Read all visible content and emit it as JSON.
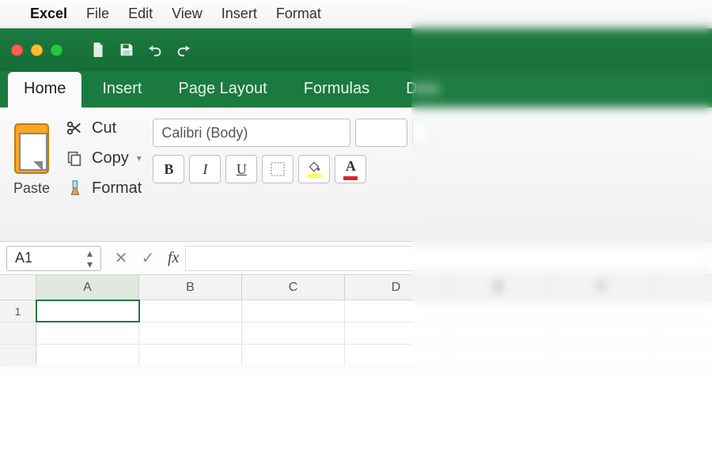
{
  "menubar": {
    "app": "Excel",
    "items": [
      "File",
      "Edit",
      "View",
      "Insert",
      "Format"
    ]
  },
  "tabs": [
    {
      "label": "Home",
      "active": true
    },
    {
      "label": "Insert",
      "active": false
    },
    {
      "label": "Page Layout",
      "active": false
    },
    {
      "label": "Formulas",
      "active": false
    },
    {
      "label": "Data",
      "active": false
    }
  ],
  "clipboard": {
    "paste": "Paste",
    "cut": "Cut",
    "copy": "Copy",
    "format": "Format"
  },
  "font": {
    "name": "Calibri (Body)",
    "bold": "B",
    "italic": "I",
    "underline": "U",
    "fontcolor": "A"
  },
  "formula_bar": {
    "namebox": "A1",
    "fx": "fx"
  },
  "columns": [
    "A",
    "B",
    "C",
    "D",
    "E",
    "F"
  ],
  "rows": [
    "1"
  ],
  "active_cell": "A1",
  "colors": {
    "excel_green": "#1b7a3f",
    "highlight_yellow": "#fffd54",
    "font_red": "#d23"
  }
}
